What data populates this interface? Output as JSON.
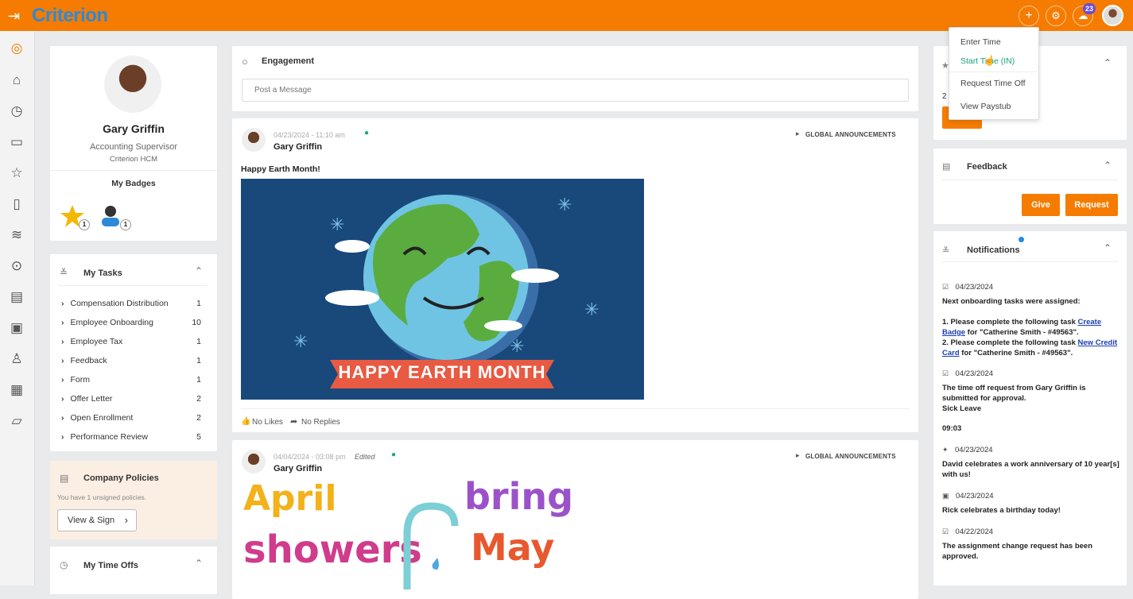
{
  "app": {
    "logo": "Criterion",
    "notification_count": "23"
  },
  "profile": {
    "name": "Gary Griffin",
    "role": "Accounting Supervisor",
    "company": "Criterion HCM",
    "badges_title": "My Badges",
    "badges": [
      {
        "icon": "star-badge-icon",
        "count": "1"
      },
      {
        "icon": "person-badge-icon",
        "count": "1"
      }
    ]
  },
  "tasks": {
    "title": "My Tasks",
    "items": [
      {
        "label": "Compensation Distribution",
        "count": "1"
      },
      {
        "label": "Employee Onboarding",
        "count": "10"
      },
      {
        "label": "Employee Tax",
        "count": "1"
      },
      {
        "label": "Feedback",
        "count": "1"
      },
      {
        "label": "Form",
        "count": "1"
      },
      {
        "label": "Offer Letter",
        "count": "2"
      },
      {
        "label": "Open Enrollment",
        "count": "2"
      },
      {
        "label": "Performance Review",
        "count": "5"
      }
    ]
  },
  "policies": {
    "title": "Company Policies",
    "text": "You have 1 unsigned policies.",
    "button": "View & Sign"
  },
  "timeoffs": {
    "title": "My Time Offs"
  },
  "engagement": {
    "title": "Engagement",
    "placeholder": "Post a Message"
  },
  "posts": [
    {
      "date": "04/23/2024 - 11:10 am",
      "author": "Gary Griffin",
      "tag": "GLOBAL ANNOUNCEMENTS",
      "title": "Happy Earth Month!",
      "banner": "HAPPY EARTH MONTH",
      "likes": "No Likes",
      "replies": "No Replies"
    },
    {
      "date": "04/04/2024 - 03:08 pm",
      "edited": "Edited",
      "author": "Gary Griffin",
      "tag": "GLOBAL ANNOUNCEMENTS",
      "art_line1": "April",
      "art_line2": "showers",
      "art_line3": "bring",
      "art_line4": "May"
    }
  ],
  "dropdown": {
    "items": [
      "Enter Time",
      "Start Time (IN)",
      "Request Time Off",
      "View Paystub"
    ]
  },
  "right_top": {
    "partial_text": "2"
  },
  "feedback": {
    "title": "Feedback",
    "give": "Give",
    "request": "Request"
  },
  "notifications": {
    "title": "Notifications",
    "items": [
      {
        "date": "04/23/2024",
        "lines": [
          "Next onboarding tasks were assigned:"
        ],
        "task1_pre": "1. Please complete the following task ",
        "task1_link": "Create Badge",
        "task1_post": " for \"Catherine Smith - #49563\".",
        "task2_pre": "2. Please complete the following task ",
        "task2_link": "New Credit Card",
        "task2_post": " for \"Catherine Smith - #49563\"."
      },
      {
        "date": "04/23/2024",
        "text": "The time off request from Gary Griffin is submitted for approval.",
        "sub": "Sick Leave",
        "time": "09:03"
      },
      {
        "date": "04/23/2024",
        "text": "David celebrates a work anniversary of 10 year[s] with us!"
      },
      {
        "date": "04/23/2024",
        "text": "Rick celebrates a birthday today!"
      },
      {
        "date": "04/22/2024",
        "text": "The assignment change request has been approved."
      }
    ]
  },
  "colors": {
    "accent": "#f57c00",
    "logo": "#2e89d6",
    "badge": "#6b4bd6"
  }
}
